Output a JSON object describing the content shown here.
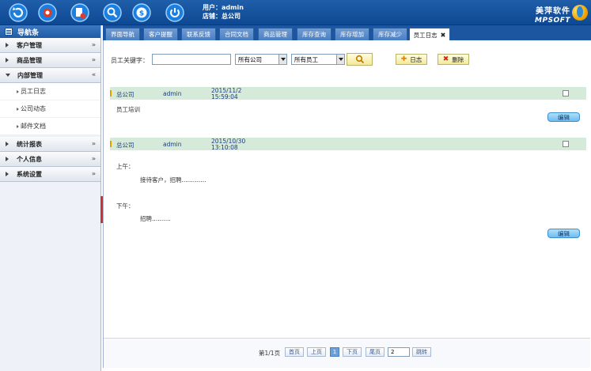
{
  "header": {
    "user_label": "用户：admin",
    "store_label": "店铺：总公司",
    "brand_cn": "美萍软件",
    "brand_en": "MPSOFT"
  },
  "sidebar": {
    "title": "导航条",
    "sections": [
      {
        "label": "客户管理"
      },
      {
        "label": "商品管理"
      },
      {
        "label": "内部管理"
      },
      {
        "label": "统计报表"
      },
      {
        "label": "个人信息"
      },
      {
        "label": "系统设置"
      }
    ],
    "subitems": [
      "员工日志",
      "公司动态",
      "邮件文档"
    ],
    "chevron": "»"
  },
  "tabs": [
    {
      "label": "界面导航"
    },
    {
      "label": "客户提醒"
    },
    {
      "label": "联系反馈"
    },
    {
      "label": "合同文档"
    },
    {
      "label": "商品管理"
    },
    {
      "label": "库存查询"
    },
    {
      "label": "库存增加"
    },
    {
      "label": "库存减少"
    },
    {
      "label": "员工日志",
      "close": "✖"
    }
  ],
  "search": {
    "keyword_label": "员工关键字：",
    "keyword_value": "",
    "company_select": "所有公司",
    "employee_select": "所有员工",
    "add_label": "日志",
    "delete_label": "删除"
  },
  "entries": [
    {
      "company": "总公司",
      "user": "admin",
      "date": "2015/11/2",
      "time": "15:59:04",
      "lines": [
        "员工培训"
      ],
      "edit_label": "编辑"
    },
    {
      "company": "总公司",
      "user": "admin",
      "date": "2015/10/30",
      "time": "13:10:08",
      "lines": [
        "上午：",
        "接待客户，招聘.............",
        "下午：",
        "招聘.........."
      ],
      "edit_label": "编辑"
    }
  ],
  "pager": {
    "info": "第1/1页",
    "first": "首页",
    "prev": "上页",
    "current": "1",
    "next": "下页",
    "last": "尾页",
    "goto_value": "2",
    "jump": "跳转"
  },
  "colors": {
    "topbar": "#1f5ea9",
    "row_highlight": "#d6ead9",
    "edit_button": "#6fbcef"
  }
}
